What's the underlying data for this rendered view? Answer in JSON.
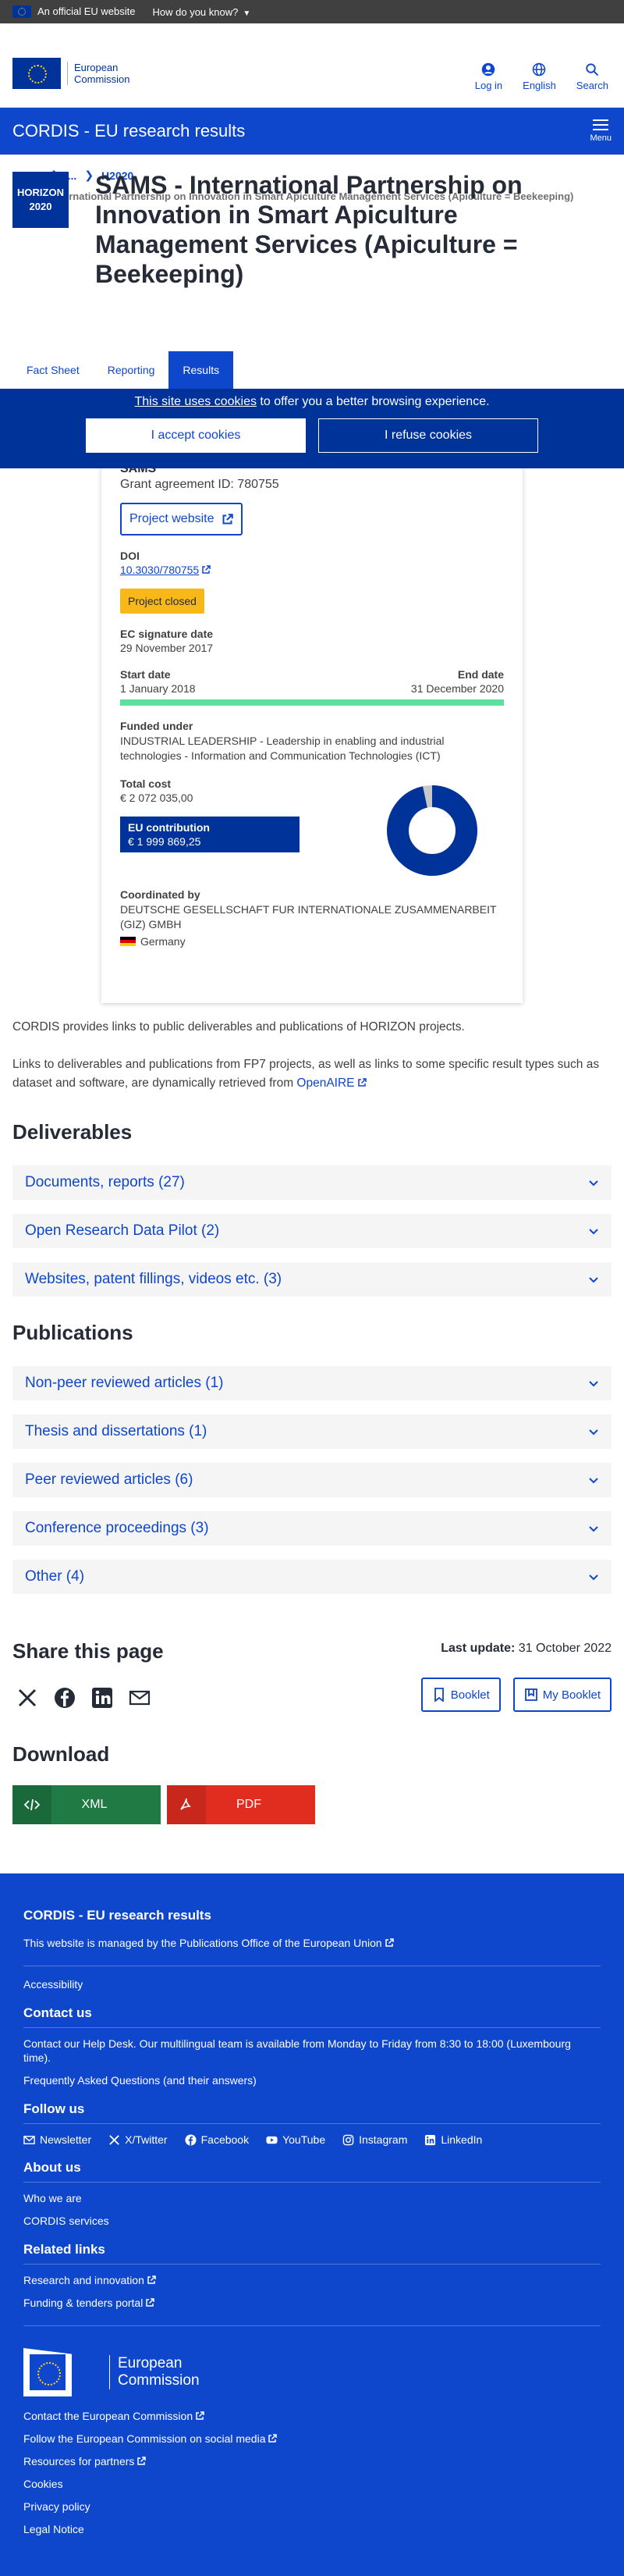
{
  "topbar": {
    "official_label": "An official EU website",
    "how_label": "How do you know?"
  },
  "header": {
    "logo_line1": "European",
    "logo_line2": "Commission",
    "login": "Log in",
    "language": "English",
    "search": "Search"
  },
  "site": {
    "name": "CORDIS - EU research results",
    "menu": "Menu"
  },
  "breadcrumb": {
    "home": "Home",
    "ellipsis": "...",
    "h2020": "H2020",
    "current": "SAMS - International Partnership on Innovation in Smart Apiculture Management Services (Apiculture = Beekeeping)"
  },
  "page": {
    "badge_line1": "HORIZON",
    "badge_line2": "2020",
    "title": "SAMS - International Partnership on Innovation in Smart Apiculture Management Services (Apiculture = Beekeeping)"
  },
  "tabs": [
    "Fact Sheet",
    "Reporting",
    "Results"
  ],
  "cookie": {
    "link": "This site uses cookies",
    "text": " to offer you a better browsing experience.",
    "accept": "I accept cookies",
    "refuse": "I refuse cookies"
  },
  "card": {
    "acronym": "SAMS",
    "grant": "Grant agreement ID: 780755",
    "website_btn": "Project website",
    "doi_label": "DOI",
    "doi_value": "10.3030/780755",
    "status": "Project closed",
    "ec_sig_label": "EC signature date",
    "ec_sig_value": "29 November 2017",
    "start_label": "Start date",
    "start_value": "1 January 2018",
    "end_label": "End date",
    "end_value": "31 December 2020",
    "funded_label": "Funded under",
    "funded_value": "INDUSTRIAL LEADERSHIP - Leadership in enabling and industrial technologies - Information and Communication Technologies (ICT)",
    "total_label": "Total cost",
    "total_value": "€ 2 072 035,00",
    "eu_label": "EU contribution",
    "eu_value": "€ 1 999 869,25",
    "eu_share": 0.9652,
    "coord_label": "Coordinated by",
    "coord_value": "DEUTSCHE GESELLSCHAFT FUR INTERNATIONALE ZUSAMMENARBEIT (GIZ) GMBH",
    "country": "Germany"
  },
  "intro": {
    "p1": "CORDIS provides links to public deliverables and publications of HORIZON projects.",
    "p2": "Links to deliverables and publications from FP7 projects, as well as links to some specific result types such as dataset and software, are dynamically retrieved from ",
    "openaire": "OpenAIRE"
  },
  "deliverables": {
    "title": "Deliverables",
    "items": [
      "Documents, reports (27)",
      "Open Research Data Pilot (2)",
      "Websites, patent fillings, videos etc. (3)"
    ]
  },
  "publications": {
    "title": "Publications",
    "items": [
      "Non-peer reviewed articles (1)",
      "Thesis and dissertations (1)",
      "Peer reviewed articles (6)",
      "Conference proceedings (3)",
      "Other (4)"
    ]
  },
  "share": {
    "title": "Share this page",
    "last_update_label": "Last update:",
    "last_update_value": " 31 October 2022",
    "booklet": "Booklet",
    "my_booklet": "My Booklet"
  },
  "download": {
    "title": "Download",
    "xml": "XML",
    "pdf": "PDF"
  },
  "footer": {
    "title": "CORDIS - EU research results",
    "managed": "This website is managed by the ",
    "office": "Publications Office of the European Union",
    "accessibility": "Accessibility",
    "contact_h": "Contact us",
    "contact_line_pre": "Contact our ",
    "helpdesk": "Help Desk",
    "contact_line_post": ". Our multilingual team is available from Monday to Friday from 8:30 to 18:00 (Luxembourg time).",
    "faq": "Frequently Asked Questions",
    "faq_post": " (and their answers)",
    "follow_h": "Follow us",
    "social": [
      "Newsletter",
      "X/Twitter",
      "Facebook",
      "YouTube",
      "Instagram",
      "LinkedIn"
    ],
    "about_h": "About us",
    "who": "Who we are",
    "services": "CORDIS services",
    "related_h": "Related links",
    "research": "Research and innovation",
    "funding": "Funding & tenders portal",
    "ec_line1": "European",
    "ec_line2": "Commission",
    "contact_ec": "Contact the European Commission",
    "follow_ec": "Follow the European Commission on social media",
    "resources": "Resources for partners",
    "cookies": "Cookies",
    "privacy": "Privacy policy",
    "legal": "Legal Notice"
  },
  "colors": {
    "brand_blue": "#0e47cb",
    "eu_blue": "#003399",
    "status_yellow": "#f8b818",
    "timeline_green": "#5ce0a0",
    "xml_green": "#1f7a44",
    "pdf_red": "#e02d20"
  }
}
